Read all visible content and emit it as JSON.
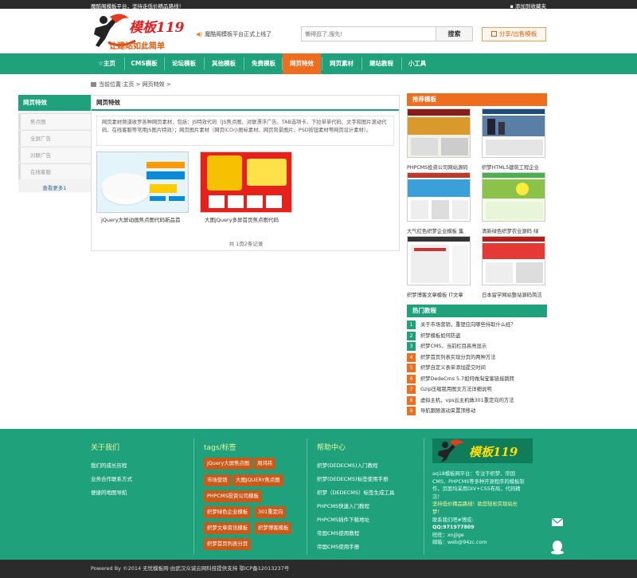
{
  "topbar": {
    "left": "魔酷阁模板平台，坚持走低价精品路线！",
    "right": "▪ 添加到收藏夹"
  },
  "header": {
    "logo_text": "模板119",
    "logo_slogan": "让建站如此简单",
    "notice": "魔酷阁模板平台正式上线了",
    "search_placeholder": "懒得逛了,搜先!",
    "search_button": "搜索",
    "share_button": "分享/出售模板"
  },
  "nav": [
    {
      "label": "☆主页"
    },
    {
      "label": "CMS模板"
    },
    {
      "label": "论坛模板"
    },
    {
      "label": "其他模板"
    },
    {
      "label": "免费模板"
    },
    {
      "label": "网页特效",
      "active": true
    },
    {
      "label": "网页素材"
    },
    {
      "label": "建站教程"
    },
    {
      "label": "小工具"
    }
  ],
  "breadcrumb": {
    "prefix": "当前位置:",
    "home": "主页",
    "sep1": " > ",
    "current": "网页特效",
    "sep2": " >"
  },
  "sidebar": {
    "title": "网页特效",
    "items": [
      "焦点图",
      "全屏广告",
      "对联广告",
      "在线客服"
    ],
    "more": "查看更多1"
  },
  "main": {
    "title": "网页特效",
    "description": "网页素材频道收罗各种网页素材，包括：JS特效代码（JS焦点图、对联漂浮广告、TAB选项卡、下拉单单代码、文字和图片滚动代码、在线客服等常用JS图片特效）；网页图片素材（网页ICO小图标素材、网页背景图片、PSD按钮素材等网页设计素材）。",
    "items": [
      {
        "caption": "jQuery大屏动画焦点图代码新品首"
      },
      {
        "caption": "大图jQuery多屏首页焦点图代码"
      }
    ],
    "pager": "共 1页2条记录"
  },
  "recommend": {
    "title": "推荐模板",
    "items": [
      "PHPCMS投资公司网站源码",
      "织梦HTML5建筑工程企业",
      "大气红色织梦企业模板 集",
      "清新绿色织梦农业源码 绿",
      "织梦博客文章模板 IT文章",
      "日本留学网站整站源码简洁"
    ]
  },
  "hot": {
    "title": "热门教程",
    "items": [
      "关于市场营销，重塑应向哪些持取什么经？",
      "织梦模板如何防盗",
      "织梦CMS，当前栏目高亮显示",
      "织梦首页列表实现分页的两种方法",
      "织梦自定义表单添加提交时间",
      "织梦DedeCms 5.7如何做淘宝客链接跳转",
      "Gzip压缩我用图文方法详细说明",
      "虚拟主机，vps云主机做301重定向的方法",
      "导航跟随滚动呆置顶移动"
    ]
  },
  "footer": {
    "about": {
      "title": "关于我们",
      "links": [
        "我们的成长历程",
        "业务合作联系方式",
        "便捷的地图导航"
      ]
    },
    "tags": {
      "title": "tags/标签",
      "items": [
        "jQuery大屏焦点图",
        "周鸿祎",
        "市场营销",
        "大图JQUERY焦点图",
        "PHPCMS投资公司模板",
        "织梦绿色企业模板",
        "301重定向",
        "织梦文章资讯模板",
        "织梦博客模板",
        "织梦首页列表分页"
      ]
    },
    "help": {
      "title": "帮助中心",
      "links": [
        "织梦(DEDECMS)入门教程",
        "织梦(DEDECMS)标签使用手册",
        "织梦（DEDECMS）标签生成工具",
        "PHPCMS快速入门教程",
        "PHPCMS插件下载地址",
        "帝国CMS使用教程",
        "帝国CMS使用手册"
      ]
    },
    "logo_text": "模板119",
    "about_lines": [
      "aq18模板网平台：专注于织梦、帝国",
      "CMS、PHPCMS等多种开源程序的模板制",
      "作，页面均采用DIV+CSS布局，代码精",
      "洁！",
      "坚持低价精品路线！助您轻松实现站长",
      "梦！",
      "联系我们吧#博成:",
      "QQ:971977809",
      "旺旺：xnjjige",
      "邮箱：web@94zc.com"
    ]
  },
  "bottom": {
    "text": "Powered By ©2014 无忧模板网·由武汉众诚云网科技提供支持 鄂ICP备12013237号"
  },
  "colors": {
    "green": "#1fa27b",
    "orange": "#ef6d1f",
    "dark": "#2b2b2b"
  }
}
